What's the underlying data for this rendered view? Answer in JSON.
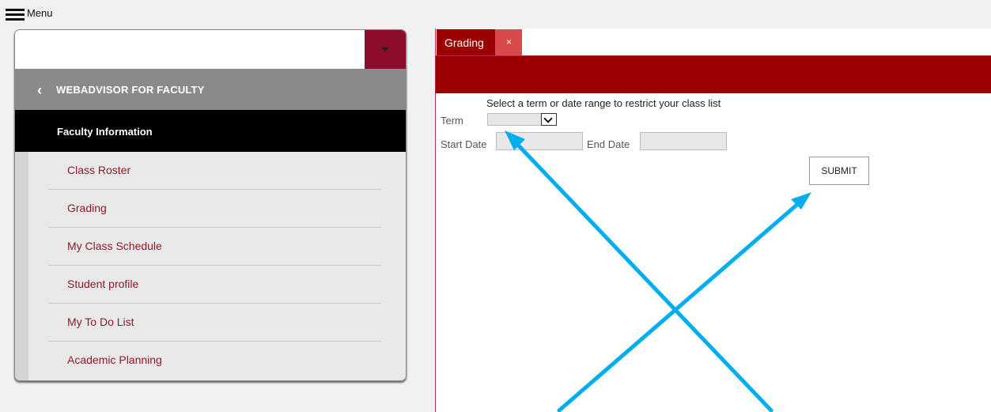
{
  "topbar": {
    "menu_label": "Menu"
  },
  "sidebar": {
    "section_title": "WEBADVISOR FOR FACULTY",
    "active_item": "Faculty Information",
    "items": [
      {
        "label": "Class Roster"
      },
      {
        "label": "Grading"
      },
      {
        "label": "My Class Schedule"
      },
      {
        "label": "Student profile"
      },
      {
        "label": "My To Do List"
      },
      {
        "label": "Academic Planning"
      }
    ]
  },
  "tabs": [
    {
      "label": "Grading",
      "close": "×"
    }
  ],
  "form": {
    "hint": "Select a term or date range to restrict your class list",
    "term_label": "Term",
    "start_date_label": "Start Date",
    "end_date_label": "End Date",
    "submit_label": "SUBMIT"
  },
  "colors": {
    "brand_red": "#9c0000",
    "maroon": "#8b0d2a",
    "annotation_arrow": "#00aeef"
  }
}
